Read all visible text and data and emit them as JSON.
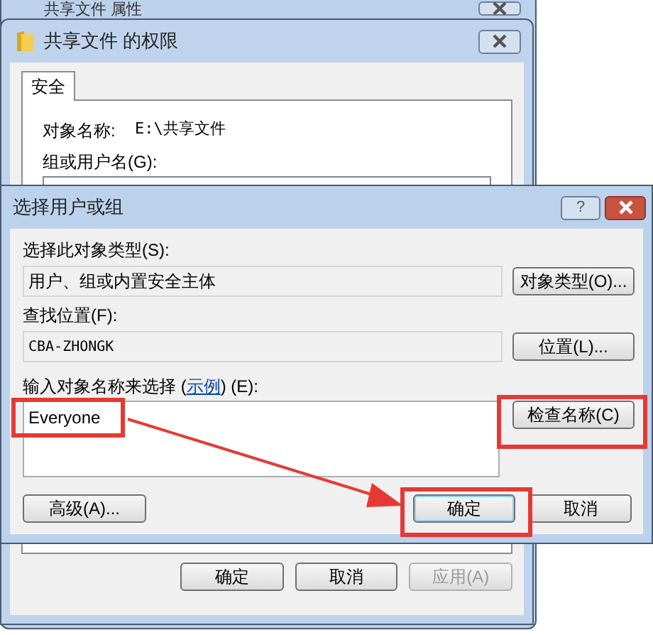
{
  "background_window": {
    "title": "共享文件 属性"
  },
  "permissions_dialog": {
    "title": "共享文件 的权限",
    "tabs": [
      {
        "label": "安全",
        "selected": true
      }
    ],
    "object_name_label": "对象名称:",
    "object_name_value": "E:\\共享文件",
    "group_label": "组或用户名(G):",
    "buttons": [
      {
        "label": "确定",
        "disabled": false
      },
      {
        "label": "取消",
        "disabled": false
      },
      {
        "label": "应用(A)",
        "disabled": true
      }
    ]
  },
  "select_dialog": {
    "title": "选择用户或组",
    "help_button": "?",
    "object_type_label": "选择此对象类型(S):",
    "object_type_value": "用户、组或内置安全主体",
    "object_type_button": "对象类型(O)...",
    "location_label": "查找位置(F):",
    "location_value": "CBA-ZHONGK",
    "location_button": "位置(L)...",
    "names_label_before": "输入对象名称来选择 (",
    "names_link": "示例",
    "names_label_after": ") (E):",
    "names_value": "Everyone",
    "check_names_button": "检查名称(C)",
    "advanced_button": "高级(A)...",
    "buttons": [
      {
        "label": "确定",
        "default": true
      },
      {
        "label": "取消",
        "default": false
      }
    ]
  }
}
